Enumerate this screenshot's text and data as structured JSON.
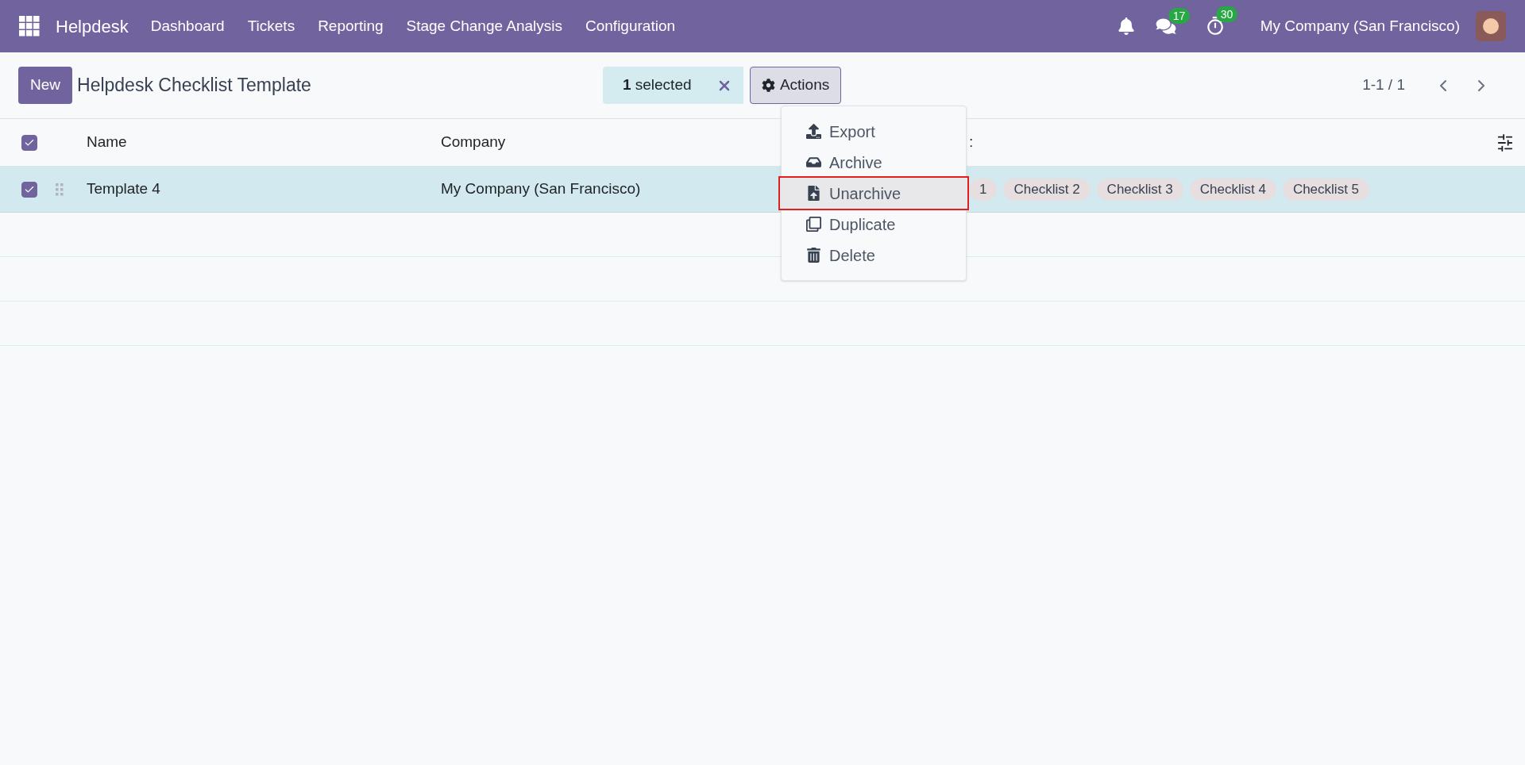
{
  "navbar": {
    "app_name": "Helpdesk",
    "menu": [
      {
        "label": "Dashboard"
      },
      {
        "label": "Tickets"
      },
      {
        "label": "Reporting"
      },
      {
        "label": "Stage Change Analysis"
      },
      {
        "label": "Configuration"
      }
    ],
    "messages_count": "17",
    "activities_count": "30",
    "company": "My Company (San Francisco)"
  },
  "control_bar": {
    "new_button": "New",
    "breadcrumb": "Helpdesk Checklist Template",
    "selection": {
      "count": "1",
      "label": "selected"
    },
    "actions_button": "Actions",
    "pager": "1-1 / 1"
  },
  "actions_menu": [
    {
      "kind": "export",
      "label": "Export",
      "highlighted": false
    },
    {
      "kind": "archive",
      "label": "Archive",
      "highlighted": false
    },
    {
      "kind": "unarchive",
      "label": "Unarchive",
      "highlighted": true
    },
    {
      "kind": "duplicate",
      "label": "Duplicate",
      "highlighted": false
    },
    {
      "kind": "delete",
      "label": "Delete",
      "highlighted": false
    }
  ],
  "table": {
    "all_checked": true,
    "columns": [
      "Name",
      "Company",
      ":"
    ],
    "rows": [
      {
        "checked": true,
        "name": "Template 4",
        "company": "My Company (San Francisco)",
        "tags": [
          "1",
          "Checklist 2",
          "Checklist 3",
          "Checklist 4",
          "Checklist 5"
        ]
      }
    ]
  }
}
